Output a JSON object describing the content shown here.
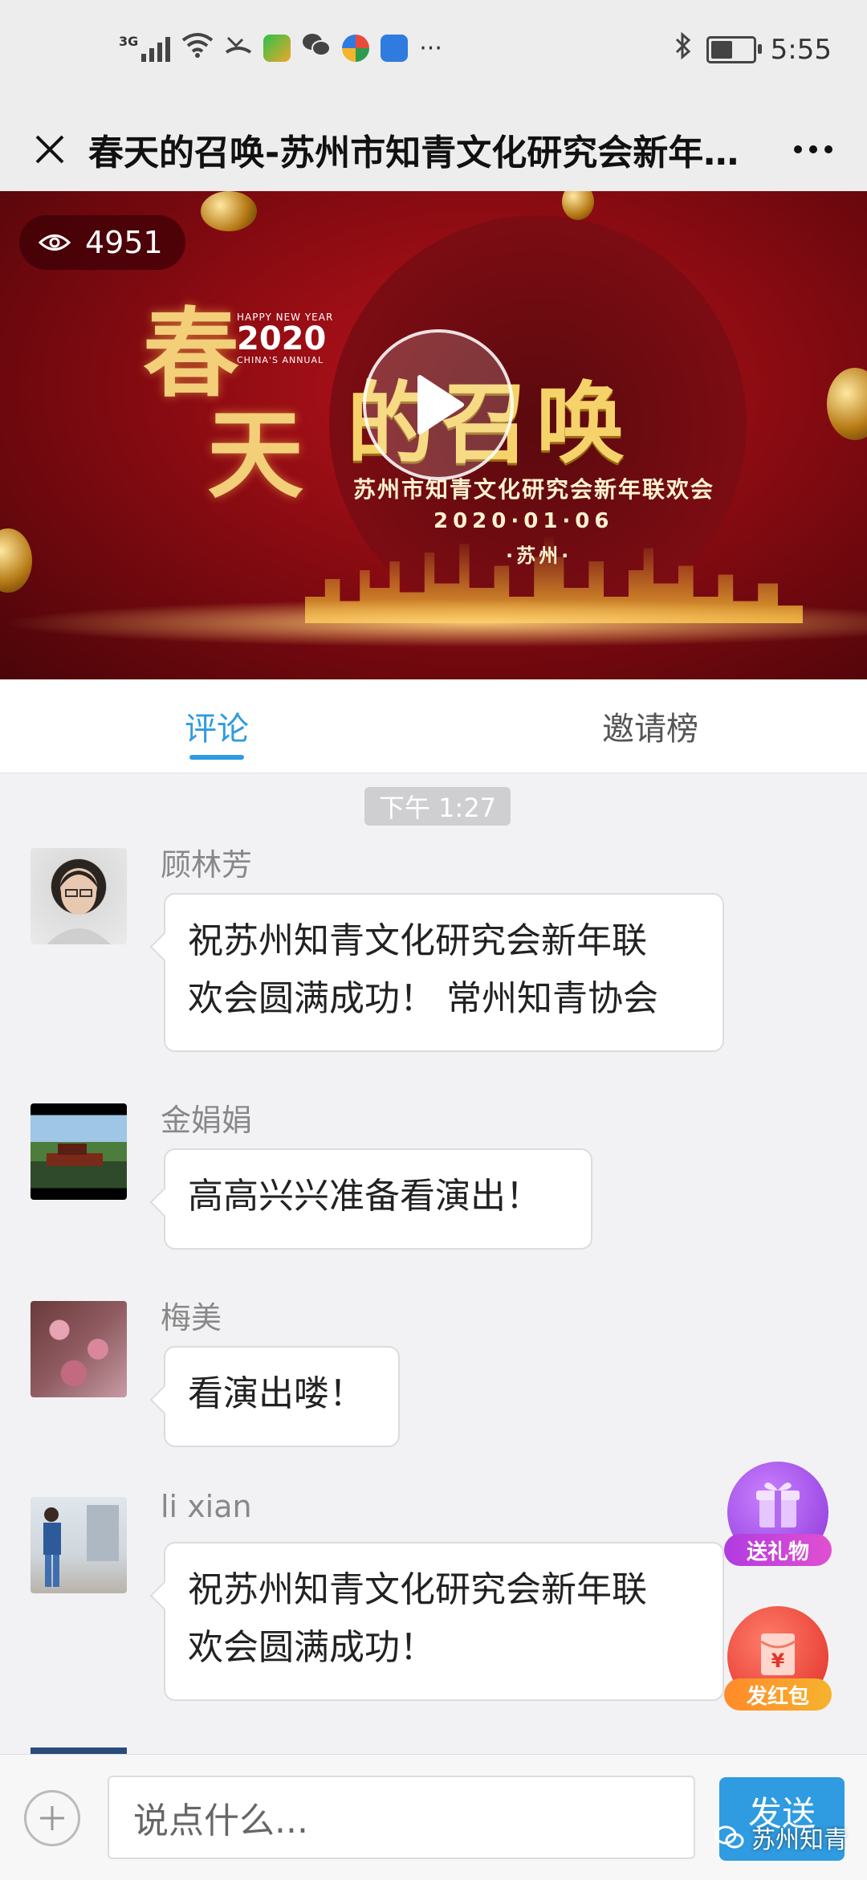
{
  "status_bar": {
    "network": "3G",
    "more": "···",
    "time": "5:55"
  },
  "header": {
    "title": "春天的召唤-苏州市知青文化研究会新年联欢会"
  },
  "video": {
    "views": "4951",
    "banner": {
      "big_left_1": "春",
      "big_left_2": "天",
      "happy_new_year": "HAPPY NEW YEAR",
      "year": "2020",
      "annual": "CHINA'S ANNUAL",
      "title": "的召唤",
      "subtitle": "苏州市知青文化研究会新年联欢会",
      "date": "2020·01·06",
      "city": "·苏州·"
    }
  },
  "tabs": [
    {
      "label": "评论",
      "active": true
    },
    {
      "label": "邀请榜",
      "active": false
    }
  ],
  "time_divider": "下午 1:27",
  "comments": [
    {
      "name": "顾林芳",
      "text_lines": [
        "祝苏州知青文化研究会新年联",
        "欢会圆满成功！ 常州知青协会"
      ]
    },
    {
      "name": "金娟娟",
      "text_lines": [
        "高高兴兴准备看演出！"
      ]
    },
    {
      "name": "梅美",
      "text_lines": [
        "看演出喽！"
      ]
    },
    {
      "name": "li xian",
      "text_lines": [
        "祝苏州知青文化研究会新年联",
        "欢会圆满成功！"
      ]
    }
  ],
  "fabs": {
    "gift_label": "送礼物",
    "redpacket_label": "发红包",
    "redpacket_symbol": "¥"
  },
  "composer": {
    "placeholder": "说点什么...",
    "send_label": "发送"
  },
  "watermark": "苏州知青",
  "colors": {
    "accent": "#2f9be0",
    "banner_red": "#8a0b12",
    "gift_purple": "#a546e8",
    "redpacket_red": "#f04a3c"
  }
}
